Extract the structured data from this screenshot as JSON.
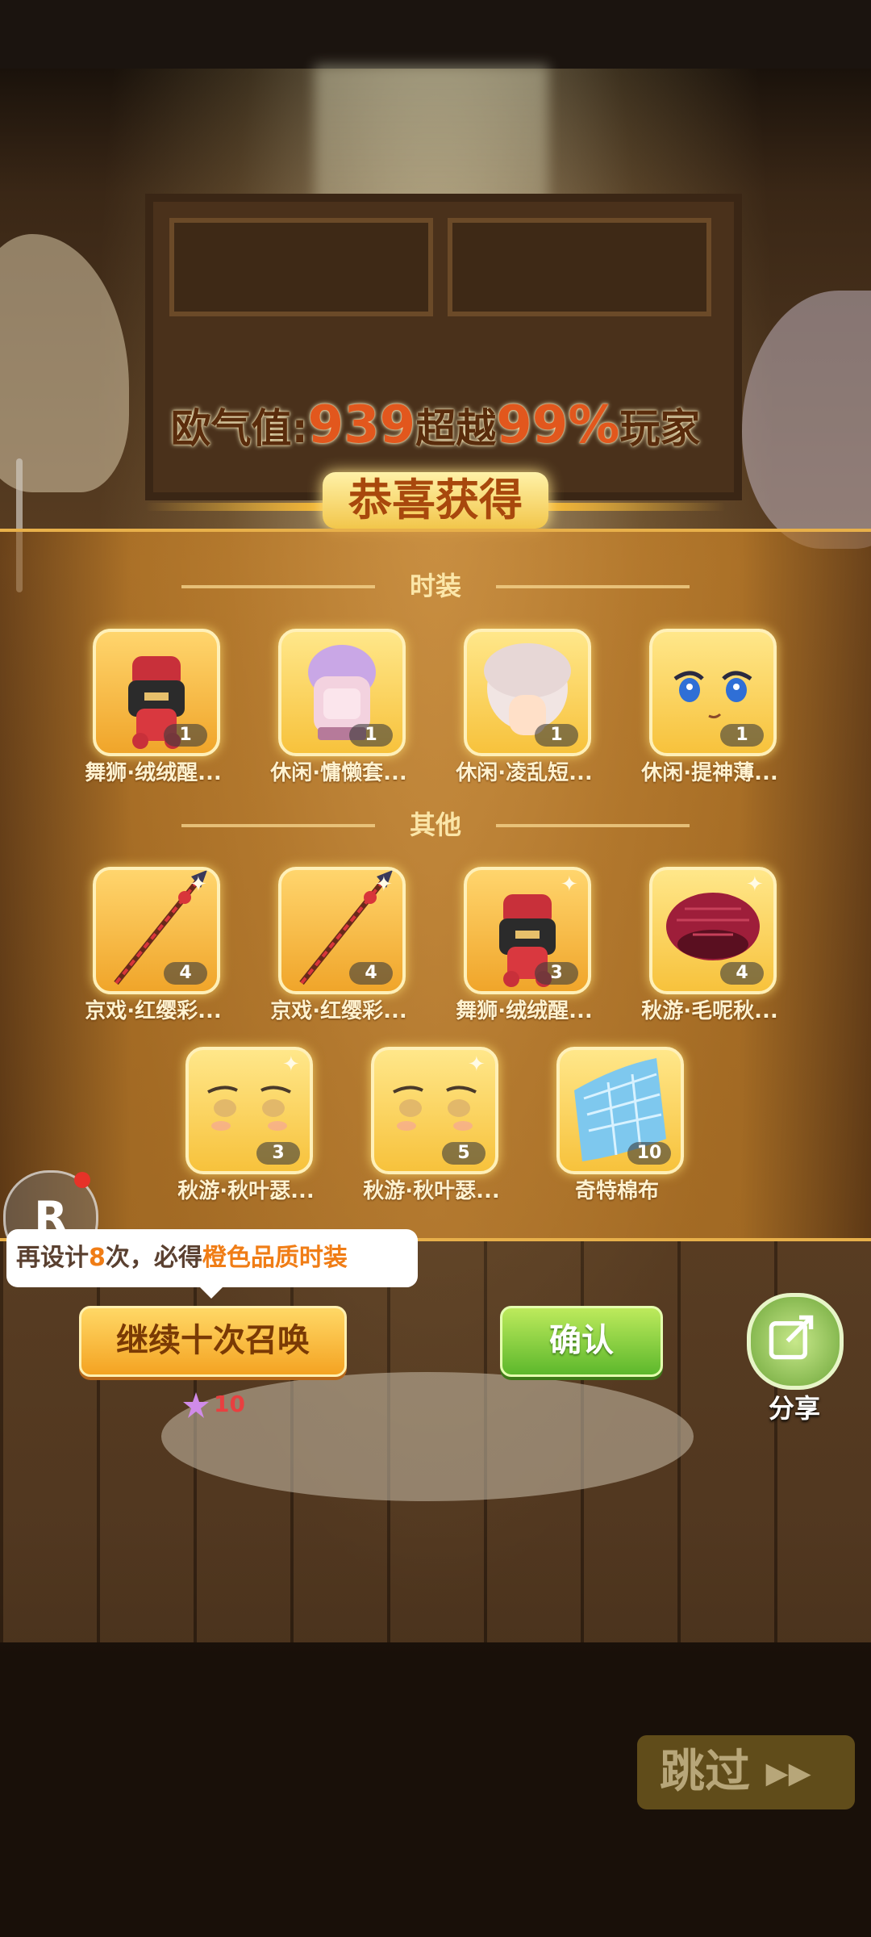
{
  "luck": {
    "prefix": "欧气值:",
    "value": "939",
    "mid": "超越",
    "percent": "99%",
    "suffix": "玩家"
  },
  "title": "恭喜获得",
  "sections": {
    "fashion": "时装",
    "other": "其他"
  },
  "fashion_items": [
    {
      "name": "舞狮·绒绒醒...",
      "count": "1",
      "icon": "lion-dance-costume-icon"
    },
    {
      "name": "休闲·慵懒套...",
      "count": "1",
      "icon": "hoodie-icon"
    },
    {
      "name": "休闲·凌乱短...",
      "count": "1",
      "icon": "short-hair-icon"
    },
    {
      "name": "休闲·提神薄...",
      "count": "1",
      "icon": "face-makeup-icon"
    }
  ],
  "other_items": [
    {
      "name": "京戏·红缨彩...",
      "count": "4",
      "icon": "red-tassel-spear-icon"
    },
    {
      "name": "京戏·红缨彩...",
      "count": "4",
      "icon": "red-tassel-spear-icon"
    },
    {
      "name": "舞狮·绒绒醒...",
      "count": "3",
      "icon": "lion-dance-costume-icon"
    },
    {
      "name": "秋游·毛呢秋...",
      "count": "4",
      "icon": "beret-icon"
    },
    {
      "name": "秋游·秋叶瑟...",
      "count": "3",
      "icon": "face-makeup-icon"
    },
    {
      "name": "秋游·秋叶瑟...",
      "count": "5",
      "icon": "face-makeup-icon"
    },
    {
      "name": "奇特棉布",
      "count": "10",
      "icon": "cotton-cloth-icon"
    }
  ],
  "tip": {
    "part1": "再设计",
    "times": "8",
    "part2": "次，必得",
    "quality": "橙色品质时装"
  },
  "badge": "R",
  "buttons": {
    "summon": "继续十次召唤",
    "confirm": "确认",
    "share": "分享",
    "skip": "跳过"
  },
  "cost": "10",
  "colors": {
    "accent_orange": "#f4a322",
    "confirm_green": "#5db82c",
    "highlight": "#f07d16"
  }
}
